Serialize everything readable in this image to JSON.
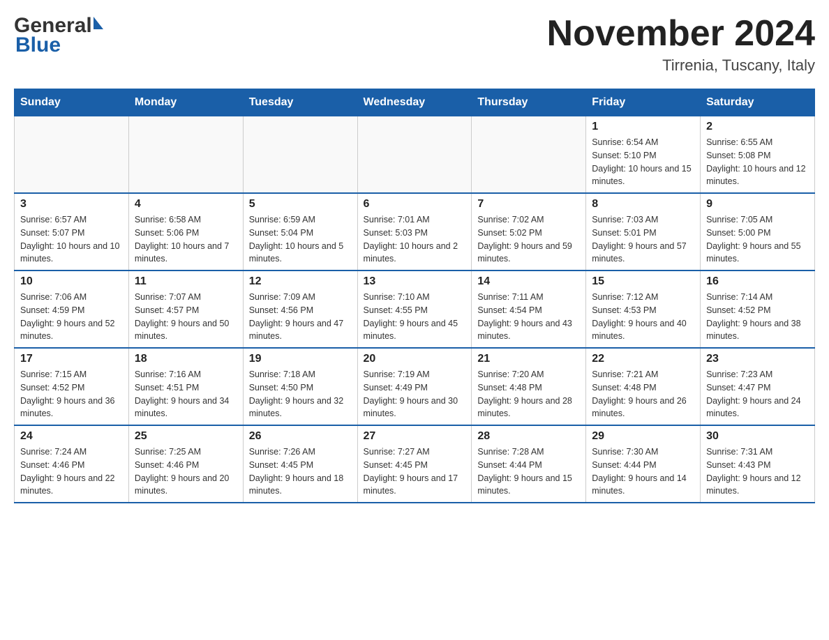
{
  "header": {
    "logo_general": "General",
    "logo_blue": "Blue",
    "month_title": "November 2024",
    "location": "Tirrenia, Tuscany, Italy"
  },
  "days_of_week": [
    "Sunday",
    "Monday",
    "Tuesday",
    "Wednesday",
    "Thursday",
    "Friday",
    "Saturday"
  ],
  "weeks": [
    [
      {
        "day": "",
        "sunrise": "",
        "sunset": "",
        "daylight": ""
      },
      {
        "day": "",
        "sunrise": "",
        "sunset": "",
        "daylight": ""
      },
      {
        "day": "",
        "sunrise": "",
        "sunset": "",
        "daylight": ""
      },
      {
        "day": "",
        "sunrise": "",
        "sunset": "",
        "daylight": ""
      },
      {
        "day": "",
        "sunrise": "",
        "sunset": "",
        "daylight": ""
      },
      {
        "day": "1",
        "sunrise": "Sunrise: 6:54 AM",
        "sunset": "Sunset: 5:10 PM",
        "daylight": "Daylight: 10 hours and 15 minutes."
      },
      {
        "day": "2",
        "sunrise": "Sunrise: 6:55 AM",
        "sunset": "Sunset: 5:08 PM",
        "daylight": "Daylight: 10 hours and 12 minutes."
      }
    ],
    [
      {
        "day": "3",
        "sunrise": "Sunrise: 6:57 AM",
        "sunset": "Sunset: 5:07 PM",
        "daylight": "Daylight: 10 hours and 10 minutes."
      },
      {
        "day": "4",
        "sunrise": "Sunrise: 6:58 AM",
        "sunset": "Sunset: 5:06 PM",
        "daylight": "Daylight: 10 hours and 7 minutes."
      },
      {
        "day": "5",
        "sunrise": "Sunrise: 6:59 AM",
        "sunset": "Sunset: 5:04 PM",
        "daylight": "Daylight: 10 hours and 5 minutes."
      },
      {
        "day": "6",
        "sunrise": "Sunrise: 7:01 AM",
        "sunset": "Sunset: 5:03 PM",
        "daylight": "Daylight: 10 hours and 2 minutes."
      },
      {
        "day": "7",
        "sunrise": "Sunrise: 7:02 AM",
        "sunset": "Sunset: 5:02 PM",
        "daylight": "Daylight: 9 hours and 59 minutes."
      },
      {
        "day": "8",
        "sunrise": "Sunrise: 7:03 AM",
        "sunset": "Sunset: 5:01 PM",
        "daylight": "Daylight: 9 hours and 57 minutes."
      },
      {
        "day": "9",
        "sunrise": "Sunrise: 7:05 AM",
        "sunset": "Sunset: 5:00 PM",
        "daylight": "Daylight: 9 hours and 55 minutes."
      }
    ],
    [
      {
        "day": "10",
        "sunrise": "Sunrise: 7:06 AM",
        "sunset": "Sunset: 4:59 PM",
        "daylight": "Daylight: 9 hours and 52 minutes."
      },
      {
        "day": "11",
        "sunrise": "Sunrise: 7:07 AM",
        "sunset": "Sunset: 4:57 PM",
        "daylight": "Daylight: 9 hours and 50 minutes."
      },
      {
        "day": "12",
        "sunrise": "Sunrise: 7:09 AM",
        "sunset": "Sunset: 4:56 PM",
        "daylight": "Daylight: 9 hours and 47 minutes."
      },
      {
        "day": "13",
        "sunrise": "Sunrise: 7:10 AM",
        "sunset": "Sunset: 4:55 PM",
        "daylight": "Daylight: 9 hours and 45 minutes."
      },
      {
        "day": "14",
        "sunrise": "Sunrise: 7:11 AM",
        "sunset": "Sunset: 4:54 PM",
        "daylight": "Daylight: 9 hours and 43 minutes."
      },
      {
        "day": "15",
        "sunrise": "Sunrise: 7:12 AM",
        "sunset": "Sunset: 4:53 PM",
        "daylight": "Daylight: 9 hours and 40 minutes."
      },
      {
        "day": "16",
        "sunrise": "Sunrise: 7:14 AM",
        "sunset": "Sunset: 4:52 PM",
        "daylight": "Daylight: 9 hours and 38 minutes."
      }
    ],
    [
      {
        "day": "17",
        "sunrise": "Sunrise: 7:15 AM",
        "sunset": "Sunset: 4:52 PM",
        "daylight": "Daylight: 9 hours and 36 minutes."
      },
      {
        "day": "18",
        "sunrise": "Sunrise: 7:16 AM",
        "sunset": "Sunset: 4:51 PM",
        "daylight": "Daylight: 9 hours and 34 minutes."
      },
      {
        "day": "19",
        "sunrise": "Sunrise: 7:18 AM",
        "sunset": "Sunset: 4:50 PM",
        "daylight": "Daylight: 9 hours and 32 minutes."
      },
      {
        "day": "20",
        "sunrise": "Sunrise: 7:19 AM",
        "sunset": "Sunset: 4:49 PM",
        "daylight": "Daylight: 9 hours and 30 minutes."
      },
      {
        "day": "21",
        "sunrise": "Sunrise: 7:20 AM",
        "sunset": "Sunset: 4:48 PM",
        "daylight": "Daylight: 9 hours and 28 minutes."
      },
      {
        "day": "22",
        "sunrise": "Sunrise: 7:21 AM",
        "sunset": "Sunset: 4:48 PM",
        "daylight": "Daylight: 9 hours and 26 minutes."
      },
      {
        "day": "23",
        "sunrise": "Sunrise: 7:23 AM",
        "sunset": "Sunset: 4:47 PM",
        "daylight": "Daylight: 9 hours and 24 minutes."
      }
    ],
    [
      {
        "day": "24",
        "sunrise": "Sunrise: 7:24 AM",
        "sunset": "Sunset: 4:46 PM",
        "daylight": "Daylight: 9 hours and 22 minutes."
      },
      {
        "day": "25",
        "sunrise": "Sunrise: 7:25 AM",
        "sunset": "Sunset: 4:46 PM",
        "daylight": "Daylight: 9 hours and 20 minutes."
      },
      {
        "day": "26",
        "sunrise": "Sunrise: 7:26 AM",
        "sunset": "Sunset: 4:45 PM",
        "daylight": "Daylight: 9 hours and 18 minutes."
      },
      {
        "day": "27",
        "sunrise": "Sunrise: 7:27 AM",
        "sunset": "Sunset: 4:45 PM",
        "daylight": "Daylight: 9 hours and 17 minutes."
      },
      {
        "day": "28",
        "sunrise": "Sunrise: 7:28 AM",
        "sunset": "Sunset: 4:44 PM",
        "daylight": "Daylight: 9 hours and 15 minutes."
      },
      {
        "day": "29",
        "sunrise": "Sunrise: 7:30 AM",
        "sunset": "Sunset: 4:44 PM",
        "daylight": "Daylight: 9 hours and 14 minutes."
      },
      {
        "day": "30",
        "sunrise": "Sunrise: 7:31 AM",
        "sunset": "Sunset: 4:43 PM",
        "daylight": "Daylight: 9 hours and 12 minutes."
      }
    ]
  ]
}
